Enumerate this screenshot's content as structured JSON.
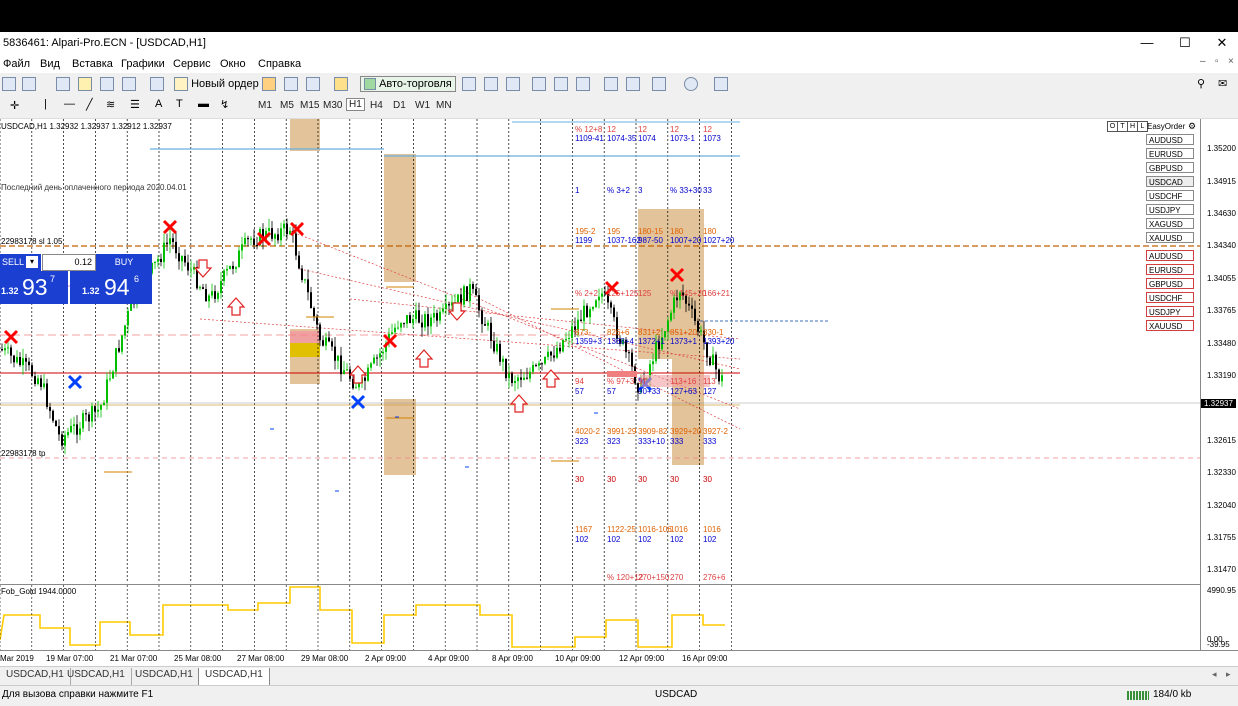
{
  "window": {
    "title": "5836461: Alpari-Pro.ECN - [USDCAD,H1]",
    "minimize": "—",
    "maximize": "☐",
    "close": "✕"
  },
  "menu": [
    "Файл",
    "Вид",
    "Вставка",
    "Графики",
    "Сервис",
    "Окно",
    "Справка"
  ],
  "toolbar": {
    "new_order": "Новый ордер",
    "auto_trading": "Авто-торговля"
  },
  "timeframes": [
    "M1",
    "M5",
    "M15",
    "M30",
    "H1",
    "H4",
    "D1",
    "W1",
    "MN"
  ],
  "active_timeframe": "H1",
  "chart": {
    "header": "USDCAD,H1  1.32932 1.32937 1.32912 1.32937",
    "sell_label": "SELL",
    "buy_label": "BUY",
    "lot": "0.12",
    "sell_big": "1.32",
    "sell_pips": "93",
    "sell_sup": "7",
    "buy_big": "1.32",
    "buy_pips": "94",
    "buy_sup": "6",
    "paid_period": "Последний день оплаченного периода 2020.04.01",
    "line_label_1": "22983178 sl 1.05",
    "line_label_2": "22983178 tp",
    "easy_order": "EasyOrder",
    "corner_buttons": [
      "O",
      "T",
      "H",
      "L"
    ]
  },
  "symbols_top": [
    "AUDUSD",
    "EURUSD",
    "GBPUSD",
    "USDCAD",
    "USDCHF",
    "USDJPY",
    "XAGUSD",
    "XAUUSD"
  ],
  "symbols_bottom": [
    "AUDUSD",
    "EURUSD",
    "GBPUSD",
    "USDCHF",
    "USDJPY",
    "XAUUSD"
  ],
  "price_scale": [
    "1.35200",
    "1.34915",
    "1.34630",
    "1.34340",
    "1.34055",
    "1.33765",
    "1.33480",
    "1.33190",
    "1.32937",
    "1.32615",
    "1.32330",
    "1.32040",
    "1.31755",
    "1.31470"
  ],
  "current_price": "1.32937",
  "indicator": {
    "label": "Fob_Gold 1944.0000",
    "scale_top": "4990.95",
    "scale_bottom": "0.00",
    "scale_bottom2": "-39.95"
  },
  "time_scale": [
    "Mar 2019",
    "19 Mar 07:00",
    "21 Mar 07:00",
    "25 Mar 08:00",
    "27 Mar 08:00",
    "29 Mar 08:00",
    "2 Apr 09:00",
    "4 Apr 09:00",
    "8 Apr 09:00",
    "10 Apr 09:00",
    "12 Apr 09:00",
    "16 Apr 09:00"
  ],
  "tabs": [
    "USDCAD,H1",
    "USDCAD,H1",
    "USDCAD,H1",
    "USDCAD,H1"
  ],
  "active_tab": 3,
  "status": {
    "help": "Для вызова справки нажмите F1",
    "symbol": "USDCAD",
    "traffic": "184/0 kb"
  },
  "annotations": {
    "r1": [
      "% 12+8",
      "12",
      "12",
      "12",
      "12"
    ],
    "r1b": [
      "1109-41",
      "1074-35",
      "1074",
      "1073-1",
      "1073"
    ],
    "r2": [
      "1",
      "% 3+2",
      "3",
      "% 33+30",
      "33"
    ],
    "r3": [
      "195-2",
      "195",
      "180-15",
      "180",
      "180"
    ],
    "r3b": [
      "1199",
      "1037-162",
      "987-50",
      "1007+20",
      "1027+20"
    ],
    "r4": [
      "% 2+2",
      "125+125",
      "125",
      "% 145+20",
      "166+21"
    ],
    "r5": [
      "873-",
      "826+6",
      "831+2",
      "851+20",
      "830-1"
    ],
    "r5b": [
      "1359+3",
      "1368+4",
      "1372+1",
      "1373+1",
      "1393+20"
    ],
    "r6": [
      "94",
      "% 97+3",
      "97",
      "113+16",
      "113"
    ],
    "r6b": [
      "57",
      "57",
      "90+33",
      "127+63",
      "127"
    ],
    "r7": [
      "4020-2",
      "3991-29",
      "3909-82",
      "3929+20",
      "3927-2"
    ],
    "r7b": [
      "323",
      "323",
      "333+10",
      "333",
      "333"
    ],
    "r8": [
      "30",
      "30",
      "30",
      "30",
      "30"
    ],
    "r9": [
      "1167",
      "1122-25",
      "1016-106",
      "1016",
      "1016"
    ],
    "r9b": [
      "102",
      "102",
      "102",
      "102",
      "102"
    ],
    "r10": [
      "% 120+12",
      "270+150",
      "270",
      "276+6"
    ]
  },
  "colors": {
    "bull_candle": "#00c000",
    "bear_candle": "#000000",
    "sell_panel": "#1a3fd1",
    "zone": "#deb887",
    "cross_red": "#ff0000",
    "cross_blue": "#0040ff",
    "indicator_line": "#ffcc00"
  }
}
